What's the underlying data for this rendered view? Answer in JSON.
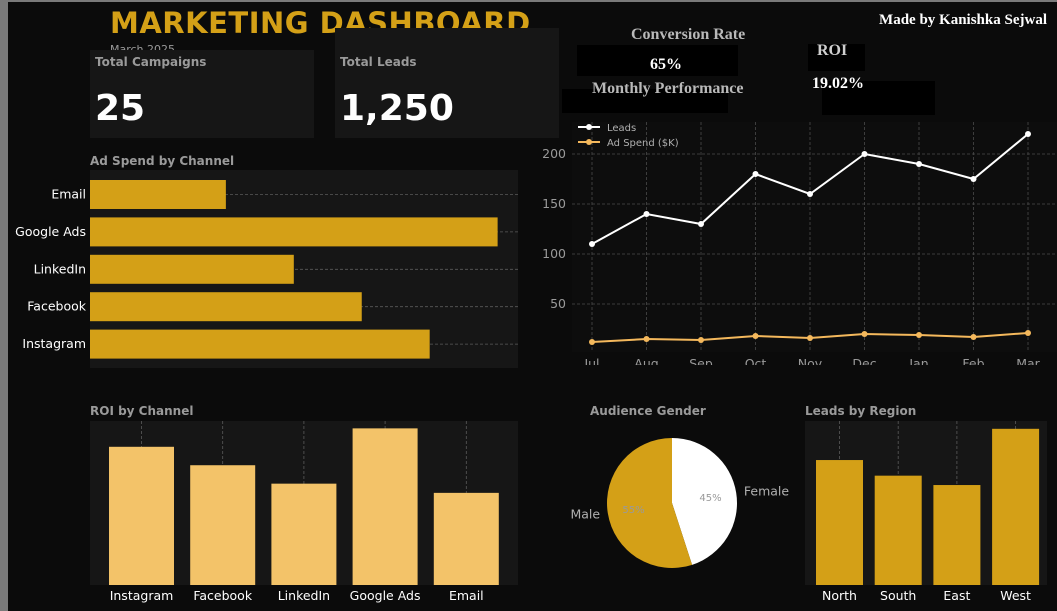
{
  "header": {
    "title": "MARKETING DASHBOARD",
    "subtitle": "March 2025",
    "credit": "Made by Kanishka Sejwal"
  },
  "kpis": {
    "total_campaigns": {
      "label": "Total Campaigns",
      "value": "25"
    },
    "total_leads": {
      "label": "Total Leads",
      "value": "1,250"
    },
    "conversion_rate": {
      "label": "Conversion Rate",
      "value": "65%"
    },
    "roi": {
      "label": "ROI",
      "value": "19.02%"
    }
  },
  "colors": {
    "gold": "#d4a017",
    "light_gold": "#f3c369",
    "ad_spend_line": "#f4b85c",
    "white": "#ffffff",
    "panel": "#161616",
    "background": "#0b0b0b"
  },
  "chart_data": [
    {
      "id": "ad_spend",
      "type": "bar",
      "orientation": "horizontal",
      "title": "Ad Spend by Channel",
      "categories": [
        "Email",
        "Google Ads",
        "LinkedIn",
        "Facebook",
        "Instagram"
      ],
      "values": [
        2000,
        6000,
        3000,
        4000,
        5000
      ],
      "xlim": [
        0,
        6300
      ],
      "grid": true
    },
    {
      "id": "monthly_performance",
      "type": "line",
      "title": "Monthly Performance",
      "x": [
        "Jul",
        "Aug",
        "Sep",
        "Oct",
        "Nov",
        "Dec",
        "Jan",
        "Feb",
        "Mar"
      ],
      "series": [
        {
          "name": "Leads",
          "color": "#ffffff",
          "values": [
            110,
            140,
            130,
            180,
            160,
            200,
            190,
            175,
            220
          ]
        },
        {
          "name": "Ad Spend ($K)",
          "color": "#f4b85c",
          "values": [
            12,
            15,
            14,
            18,
            16,
            20,
            19,
            17,
            21
          ]
        }
      ],
      "yticks": [
        50,
        100,
        150,
        200
      ],
      "ylim": [
        2,
        232
      ],
      "legend": "top-left",
      "grid": true
    },
    {
      "id": "roi_by_channel",
      "type": "bar",
      "title": "ROI by Channel",
      "categories": [
        "Instagram",
        "Facebook",
        "LinkedIn",
        "Google Ads",
        "Email"
      ],
      "values": [
        15,
        13,
        11,
        17,
        10
      ],
      "ylim": [
        0,
        17.8
      ],
      "grid": true
    },
    {
      "id": "audience_gender",
      "type": "pie",
      "title": "Audience Gender",
      "categories": [
        "Female",
        "Male"
      ],
      "values": [
        45,
        55
      ],
      "labels": [
        "45%",
        "55%"
      ],
      "colors": [
        "#ffffff",
        "#d4a017"
      ]
    },
    {
      "id": "leads_by_region",
      "type": "bar",
      "title": "Leads by Region",
      "categories": [
        "North",
        "South",
        "East",
        "West"
      ],
      "values": [
        400,
        350,
        320,
        500
      ],
      "ylim": [
        0,
        525
      ],
      "grid": true
    }
  ]
}
